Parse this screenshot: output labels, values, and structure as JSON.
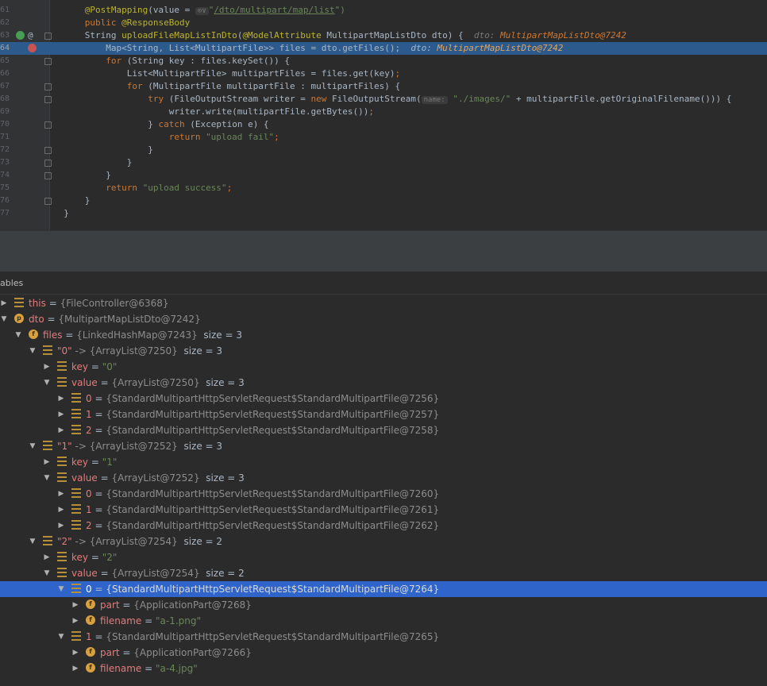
{
  "editor": {
    "code_lines": [
      {
        "num": "61",
        "icon": "",
        "fold": false,
        "highlighted": false,
        "indent": "      ",
        "tokens": [
          {
            "t": "@PostMapping",
            "c": "ann"
          },
          {
            "t": "(value = ",
            "c": ""
          },
          {
            "t": "⊙∨",
            "c": "hint"
          },
          {
            "t": "\"",
            "c": "str"
          },
          {
            "t": "/dto/multipart/map/list",
            "c": "lnk"
          },
          {
            "t": "\")",
            "c": "str"
          }
        ]
      },
      {
        "num": "62",
        "icon": "",
        "fold": false,
        "highlighted": false,
        "indent": "      ",
        "tokens": [
          {
            "t": "public ",
            "c": "kw"
          },
          {
            "t": "@ResponseBody",
            "c": "ann"
          }
        ]
      },
      {
        "num": "63",
        "icon": "impl-at",
        "fold": true,
        "highlighted": false,
        "indent": "      ",
        "tokens": [
          {
            "t": "String ",
            "c": ""
          },
          {
            "t": "uploadFileMapListInDto",
            "c": "ann"
          },
          {
            "t": "(",
            "c": ""
          },
          {
            "t": "@ModelAttribute",
            "c": "ann"
          },
          {
            "t": " MultipartMapListDto dto) {  ",
            "c": ""
          },
          {
            "t": "dto: ",
            "c": "dbg"
          },
          {
            "t": "MultipartMapListDto@7242",
            "c": "dbgv"
          }
        ]
      },
      {
        "num": "64",
        "icon": "bp",
        "fold": false,
        "highlighted": true,
        "indent": "          ",
        "tokens": [
          {
            "t": "Map<String, List<MultipartFile>> files = dto.getFiles();  ",
            "c": ""
          },
          {
            "t": "dto: ",
            "c": "dbg-hl"
          },
          {
            "t": "MultipartMapListDto@7242",
            "c": "dbgv-hl"
          }
        ]
      },
      {
        "num": "65",
        "icon": "",
        "fold": true,
        "highlighted": false,
        "indent": "          ",
        "tokens": [
          {
            "t": "for ",
            "c": "kw"
          },
          {
            "t": "(String key : files.keySet()) {",
            "c": ""
          }
        ]
      },
      {
        "num": "66",
        "icon": "",
        "fold": false,
        "highlighted": false,
        "indent": "              ",
        "tokens": [
          {
            "t": "List<MultipartFile> multipartFiles = files.get(key)",
            "c": ""
          },
          {
            "t": ";",
            "c": "kw"
          }
        ]
      },
      {
        "num": "67",
        "icon": "",
        "fold": true,
        "highlighted": false,
        "indent": "              ",
        "tokens": [
          {
            "t": "for ",
            "c": "kw"
          },
          {
            "t": "(MultipartFile multipartFile : multipartFiles) {",
            "c": ""
          }
        ]
      },
      {
        "num": "68",
        "icon": "",
        "fold": true,
        "highlighted": false,
        "indent": "                  ",
        "tokens": [
          {
            "t": "try ",
            "c": "kw"
          },
          {
            "t": "(FileOutputStream writer = ",
            "c": ""
          },
          {
            "t": "new ",
            "c": "kw"
          },
          {
            "t": "FileOutputStream(",
            "c": ""
          },
          {
            "t": "name:",
            "c": "hint"
          },
          {
            "t": " \"./images/\"",
            "c": "str"
          },
          {
            "t": " + multipartFile.getOriginalFilename())) {",
            "c": ""
          }
        ]
      },
      {
        "num": "69",
        "icon": "",
        "fold": false,
        "highlighted": false,
        "indent": "                      ",
        "tokens": [
          {
            "t": "writer.write(multipartFile.getBytes())",
            "c": ""
          },
          {
            "t": ";",
            "c": "kw"
          }
        ]
      },
      {
        "num": "70",
        "icon": "",
        "fold": true,
        "highlighted": false,
        "indent": "                  ",
        "tokens": [
          {
            "t": "} ",
            "c": ""
          },
          {
            "t": "catch ",
            "c": "kw"
          },
          {
            "t": "(Exception e) {",
            "c": ""
          }
        ]
      },
      {
        "num": "71",
        "icon": "",
        "fold": false,
        "highlighted": false,
        "indent": "                      ",
        "tokens": [
          {
            "t": "return ",
            "c": "kw"
          },
          {
            "t": "\"upload fail\"",
            "c": "str"
          },
          {
            "t": ";",
            "c": "kw"
          }
        ]
      },
      {
        "num": "72",
        "icon": "",
        "fold": true,
        "highlighted": false,
        "indent": "                  ",
        "tokens": [
          {
            "t": "}",
            "c": ""
          }
        ]
      },
      {
        "num": "73",
        "icon": "",
        "fold": true,
        "highlighted": false,
        "indent": "              ",
        "tokens": [
          {
            "t": "}",
            "c": ""
          }
        ]
      },
      {
        "num": "74",
        "icon": "",
        "fold": true,
        "highlighted": false,
        "indent": "          ",
        "tokens": [
          {
            "t": "}",
            "c": ""
          }
        ]
      },
      {
        "num": "75",
        "icon": "",
        "fold": false,
        "highlighted": false,
        "indent": "          ",
        "tokens": [
          {
            "t": "return ",
            "c": "kw"
          },
          {
            "t": "\"upload success\"",
            "c": "str"
          },
          {
            "t": ";",
            "c": "kw"
          }
        ]
      },
      {
        "num": "76",
        "icon": "",
        "fold": true,
        "highlighted": false,
        "indent": "      ",
        "tokens": [
          {
            "t": "}",
            "c": ""
          }
        ]
      },
      {
        "num": "77",
        "icon": "",
        "fold": false,
        "highlighted": false,
        "indent": "  ",
        "tokens": [
          {
            "t": "}",
            "c": ""
          }
        ]
      }
    ]
  },
  "variables_panel": {
    "title": "ables",
    "rows": [
      {
        "depth": 0,
        "arrow": "right",
        "icon": "field-lines-icon",
        "name": "this",
        "value": "{FileController@6368}",
        "size": "",
        "is_str": false,
        "selected": false
      },
      {
        "depth": 0,
        "arrow": "down",
        "icon": "parameter-icon",
        "name": "dto",
        "value": "{MultipartMapListDto@7242}",
        "size": "",
        "is_str": false,
        "selected": false
      },
      {
        "depth": 1,
        "arrow": "down",
        "icon": "field-icon",
        "name": "files",
        "value": "{LinkedHashMap@7243}",
        "size": "size = 3",
        "is_str": false,
        "selected": false
      },
      {
        "depth": 2,
        "arrow": "down",
        "icon": "field-lines-icon",
        "name": "\"0\"",
        "value": "-> {ArrayList@7250}",
        "size": "size = 3",
        "is_str": true,
        "selected": false
      },
      {
        "depth": 3,
        "arrow": "right",
        "icon": "field-lines-icon",
        "name": "key",
        "value": "\"0\"",
        "size": "",
        "is_str": true,
        "selected": false
      },
      {
        "depth": 3,
        "arrow": "down",
        "icon": "field-lines-icon",
        "name": "value",
        "value": "{ArrayList@7250}",
        "size": "size = 3",
        "is_str": false,
        "selected": false
      },
      {
        "depth": 4,
        "arrow": "right",
        "icon": "field-lines-icon",
        "name": "0",
        "value": "{StandardMultipartHttpServletRequest$StandardMultipartFile@7256}",
        "size": "",
        "is_str": false,
        "selected": false
      },
      {
        "depth": 4,
        "arrow": "right",
        "icon": "field-lines-icon",
        "name": "1",
        "value": "{StandardMultipartHttpServletRequest$StandardMultipartFile@7257}",
        "size": "",
        "is_str": false,
        "selected": false
      },
      {
        "depth": 4,
        "arrow": "right",
        "icon": "field-lines-icon",
        "name": "2",
        "value": "{StandardMultipartHttpServletRequest$StandardMultipartFile@7258}",
        "size": "",
        "is_str": false,
        "selected": false
      },
      {
        "depth": 2,
        "arrow": "down",
        "icon": "field-lines-icon",
        "name": "\"1\"",
        "value": "-> {ArrayList@7252}",
        "size": "size = 3",
        "is_str": true,
        "selected": false
      },
      {
        "depth": 3,
        "arrow": "right",
        "icon": "field-lines-icon",
        "name": "key",
        "value": "\"1\"",
        "size": "",
        "is_str": true,
        "selected": false
      },
      {
        "depth": 3,
        "arrow": "down",
        "icon": "field-lines-icon",
        "name": "value",
        "value": "{ArrayList@7252}",
        "size": "size = 3",
        "is_str": false,
        "selected": false
      },
      {
        "depth": 4,
        "arrow": "right",
        "icon": "field-lines-icon",
        "name": "0",
        "value": "{StandardMultipartHttpServletRequest$StandardMultipartFile@7260}",
        "size": "",
        "is_str": false,
        "selected": false
      },
      {
        "depth": 4,
        "arrow": "right",
        "icon": "field-lines-icon",
        "name": "1",
        "value": "{StandardMultipartHttpServletRequest$StandardMultipartFile@7261}",
        "size": "",
        "is_str": false,
        "selected": false
      },
      {
        "depth": 4,
        "arrow": "right",
        "icon": "field-lines-icon",
        "name": "2",
        "value": "{StandardMultipartHttpServletRequest$StandardMultipartFile@7262}",
        "size": "",
        "is_str": false,
        "selected": false
      },
      {
        "depth": 2,
        "arrow": "down",
        "icon": "field-lines-icon",
        "name": "\"2\"",
        "value": "-> {ArrayList@7254}",
        "size": "size = 2",
        "is_str": true,
        "selected": false
      },
      {
        "depth": 3,
        "arrow": "right",
        "icon": "field-lines-icon",
        "name": "key",
        "value": "\"2\"",
        "size": "",
        "is_str": true,
        "selected": false
      },
      {
        "depth": 3,
        "arrow": "down",
        "icon": "field-lines-icon",
        "name": "value",
        "value": "{ArrayList@7254}",
        "size": "size = 2",
        "is_str": false,
        "selected": false
      },
      {
        "depth": 4,
        "arrow": "down",
        "icon": "field-lines-icon",
        "name": "0",
        "value": "{StandardMultipartHttpServletRequest$StandardMultipartFile@7264}",
        "size": "",
        "is_str": false,
        "selected": true
      },
      {
        "depth": 5,
        "arrow": "right",
        "icon": "field-icon",
        "name": "part",
        "value": "{ApplicationPart@7268}",
        "size": "",
        "is_str": false,
        "selected": false
      },
      {
        "depth": 5,
        "arrow": "right",
        "icon": "field-icon",
        "name": "filename",
        "value": "\"a-1.png\"",
        "size": "",
        "is_str": true,
        "selected": false
      },
      {
        "depth": 4,
        "arrow": "down",
        "icon": "field-lines-icon",
        "name": "1",
        "value": "{StandardMultipartHttpServletRequest$StandardMultipartFile@7265}",
        "size": "",
        "is_str": false,
        "selected": false
      },
      {
        "depth": 5,
        "arrow": "right",
        "icon": "field-icon",
        "name": "part",
        "value": "{ApplicationPart@7266}",
        "size": "",
        "is_str": false,
        "selected": false
      },
      {
        "depth": 5,
        "arrow": "right",
        "icon": "field-icon",
        "name": "filename",
        "value": "\"a-4.jpg\"",
        "size": "",
        "is_str": true,
        "selected": false
      }
    ]
  },
  "colors": {
    "editor_bg": "#2b2b2b",
    "selection": "#2f65ca",
    "current_line": "#2d5a8c",
    "keyword": "#cc7832",
    "annotation": "#bbb529",
    "string": "#6a8759",
    "var_name": "#e27c7c",
    "breakpoint": "#c75450"
  }
}
